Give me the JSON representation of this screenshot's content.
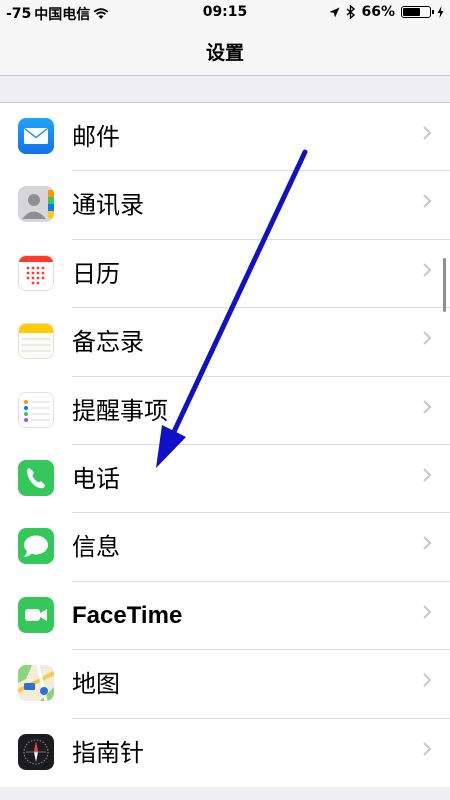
{
  "status_bar": {
    "signal": "-75",
    "carrier": "中国电信",
    "time": "09:15",
    "battery": "66%",
    "battery_level": 0.66
  },
  "nav": {
    "title": "设置"
  },
  "items": [
    {
      "label": "邮件",
      "icon": "mail-icon",
      "color": "#1a8cf5"
    },
    {
      "label": "通讯录",
      "icon": "contacts-icon",
      "color": "#9a9aa0"
    },
    {
      "label": "日历",
      "icon": "calendar-icon",
      "color": "#ff3b30"
    },
    {
      "label": "备忘录",
      "icon": "notes-icon",
      "color": "#ffcc00"
    },
    {
      "label": "提醒事项",
      "icon": "reminders-icon",
      "color": "#ffffff"
    },
    {
      "label": "电话",
      "icon": "phone-icon",
      "color": "#34c759"
    },
    {
      "label": "信息",
      "icon": "messages-icon",
      "color": "#34c759"
    },
    {
      "label": "FaceTime",
      "icon": "facetime-icon",
      "color": "#34c759"
    },
    {
      "label": "地图",
      "icon": "maps-icon",
      "color": "#8fd37a"
    },
    {
      "label": "指南针",
      "icon": "compass-icon",
      "color": "#1c1c1e"
    }
  ],
  "annotation": {
    "type": "arrow",
    "color": "#1010c8",
    "points_to": "电话"
  }
}
